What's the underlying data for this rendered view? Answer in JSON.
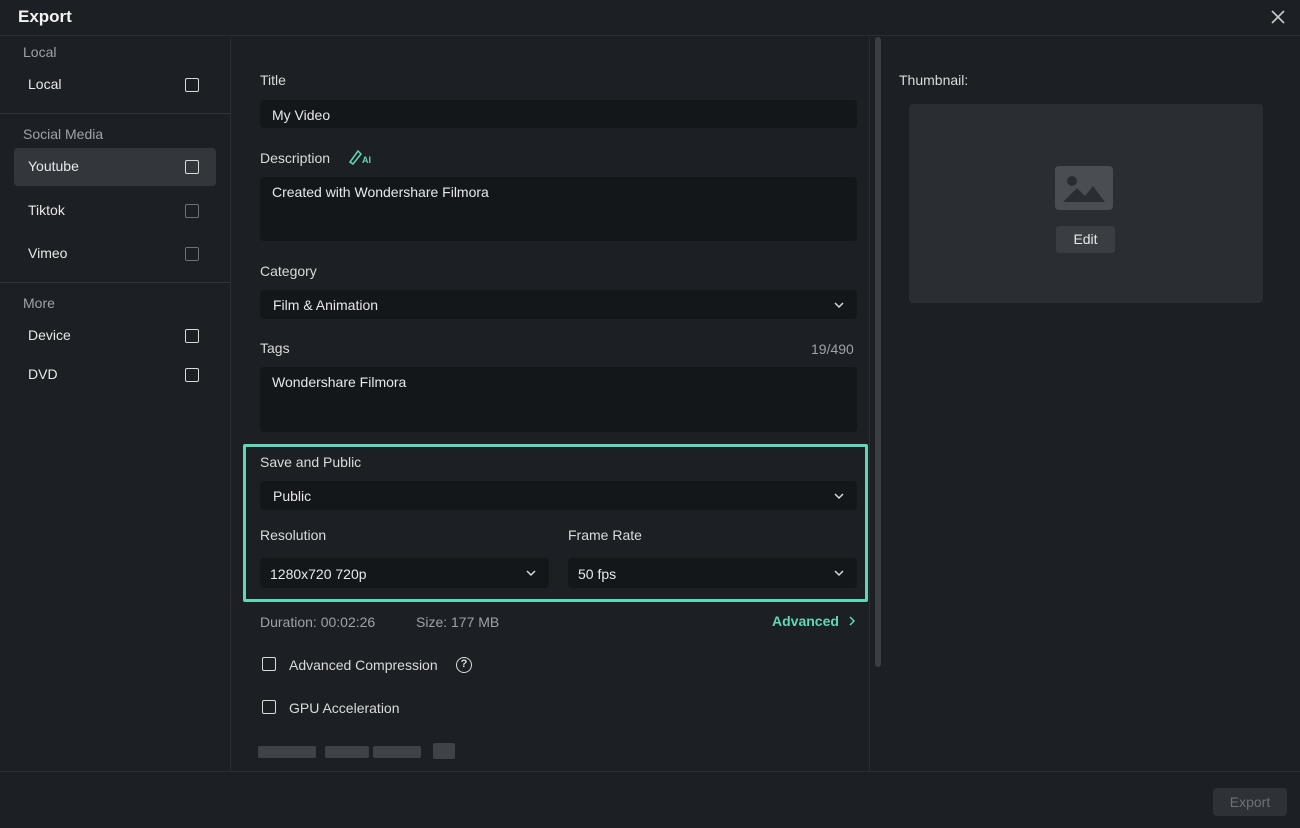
{
  "window": {
    "title": "Export"
  },
  "sidebar": {
    "groups": [
      {
        "label": "Local",
        "items": [
          {
            "label": "Local"
          }
        ]
      },
      {
        "label": "Social Media",
        "items": [
          {
            "label": "Youtube",
            "active": true
          },
          {
            "label": "Tiktok"
          },
          {
            "label": "Vimeo"
          }
        ]
      },
      {
        "label": "More",
        "items": [
          {
            "label": "Device"
          },
          {
            "label": "DVD"
          }
        ]
      }
    ]
  },
  "form": {
    "title_label": "Title",
    "title_value": "My Video",
    "description_label": "Description",
    "description_value": "Created with Wondershare Filmora",
    "category_label": "Category",
    "category_value": "Film & Animation",
    "tags_label": "Tags",
    "tags_count": "19/490",
    "tags_value": "Wondershare Filmora",
    "save_public_label": "Save and Public",
    "save_public_value": "Public",
    "resolution_label": "Resolution",
    "resolution_value": "1280x720 720p",
    "frame_rate_label": "Frame Rate",
    "frame_rate_value": "50 fps",
    "duration": "Duration: 00:02:26",
    "size": "Size:  177 MB",
    "advanced_label": "Advanced",
    "advanced_compression_label": "Advanced Compression",
    "gpu_acceleration_label": "GPU Acceleration"
  },
  "thumbnail": {
    "label": "Thumbnail:",
    "edit_label": "Edit"
  },
  "footer": {
    "export_label": "Export"
  },
  "colors": {
    "accent": "#5ed8b8",
    "background": "#1c1f23",
    "field": "#14171a"
  },
  "icons": [
    "close-icon",
    "ai-pen-icon",
    "chevron-down-icon",
    "chevron-right-icon",
    "help-icon",
    "image-icon",
    "checkbox-icon"
  ]
}
